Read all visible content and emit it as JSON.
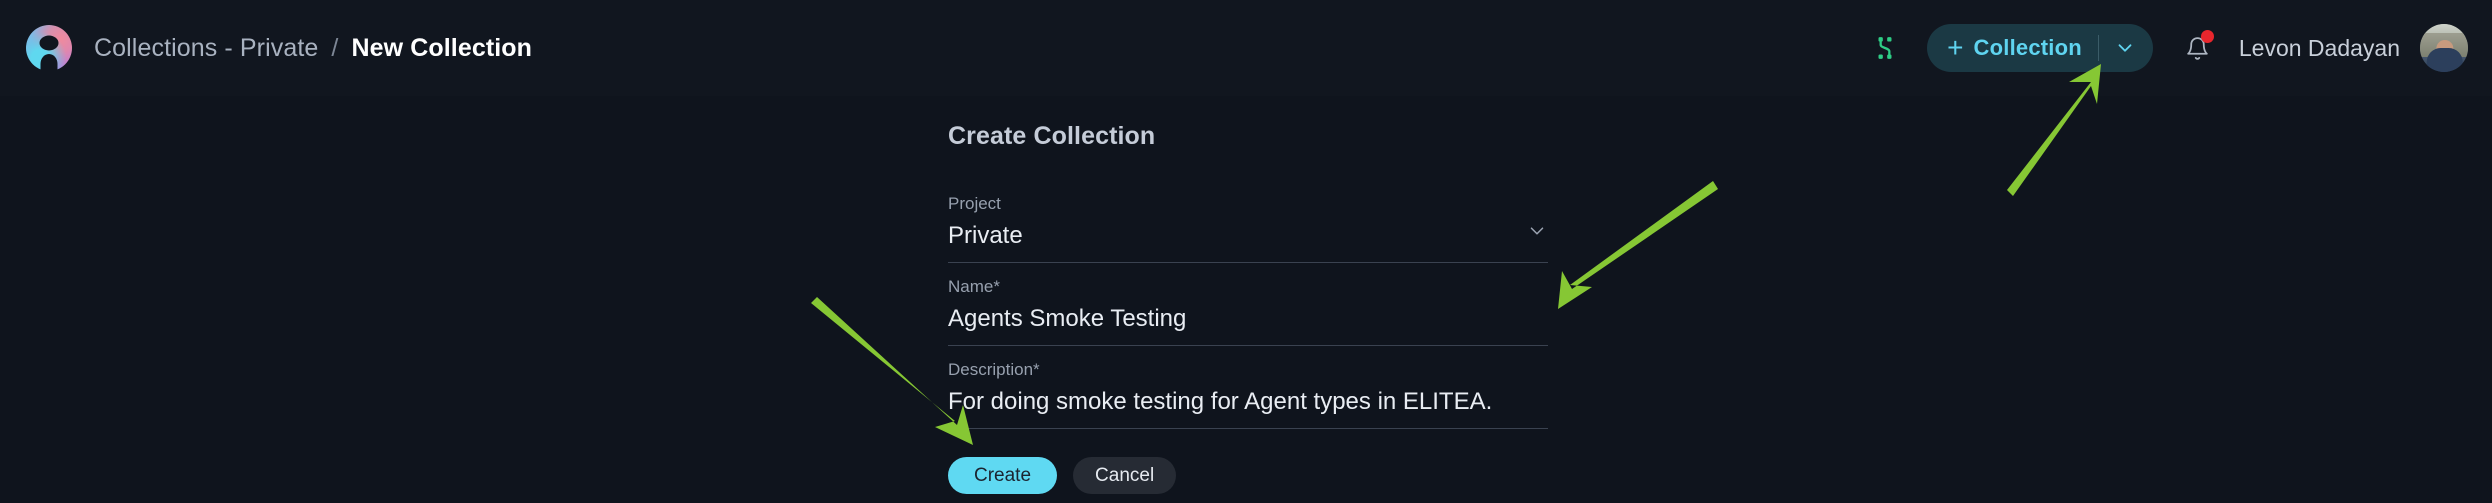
{
  "header": {
    "logo_icon": "elitea-logo-icon",
    "breadcrumb": {
      "root": "Collections - Private",
      "separator": "/",
      "current": "New Collection"
    },
    "toolbar": {
      "flow_icon": "shuffle-flow-icon",
      "flow_icon_color": "#2ecc85",
      "collection_button": {
        "plus_icon": "plus-icon",
        "label": "Collection",
        "chevron_icon": "chevron-down-icon",
        "accent_color": "#5fd4f0",
        "background_color": "#1b3944"
      },
      "notifications": {
        "icon": "bell-icon",
        "has_unread": true,
        "badge_color": "#e8262d"
      },
      "user_name": "Levon Dadayan",
      "avatar_icon": "user-avatar"
    }
  },
  "main": {
    "title": "Create Collection",
    "fields": [
      {
        "name": "project",
        "label": "Project",
        "required": false,
        "value": "Private",
        "control": "select",
        "chevron_icon": "chevron-down-icon"
      },
      {
        "name": "name",
        "label": "Name",
        "required": true,
        "required_marker": "*",
        "value": "Agents Smoke Testing",
        "control": "text"
      },
      {
        "name": "description",
        "label": "Description",
        "required": true,
        "required_marker": "*",
        "value": "For doing smoke testing for Agent types in ELITEA.",
        "control": "text"
      }
    ],
    "actions": {
      "create_label": "Create",
      "cancel_label": "Cancel",
      "create_color": "#5fd9f2",
      "cancel_color": "#262b34"
    }
  },
  "annotations": {
    "color": "#86c734",
    "arrows": [
      {
        "name": "arrow-to-name-field",
        "direction": "down-left"
      },
      {
        "name": "arrow-to-create-button",
        "direction": "down-right"
      },
      {
        "name": "arrow-to-collection-button",
        "direction": "up-right"
      }
    ]
  },
  "theme": {
    "background": "#0f141d",
    "topbar_background": "#11161f",
    "field_underline": "#3a4250"
  }
}
